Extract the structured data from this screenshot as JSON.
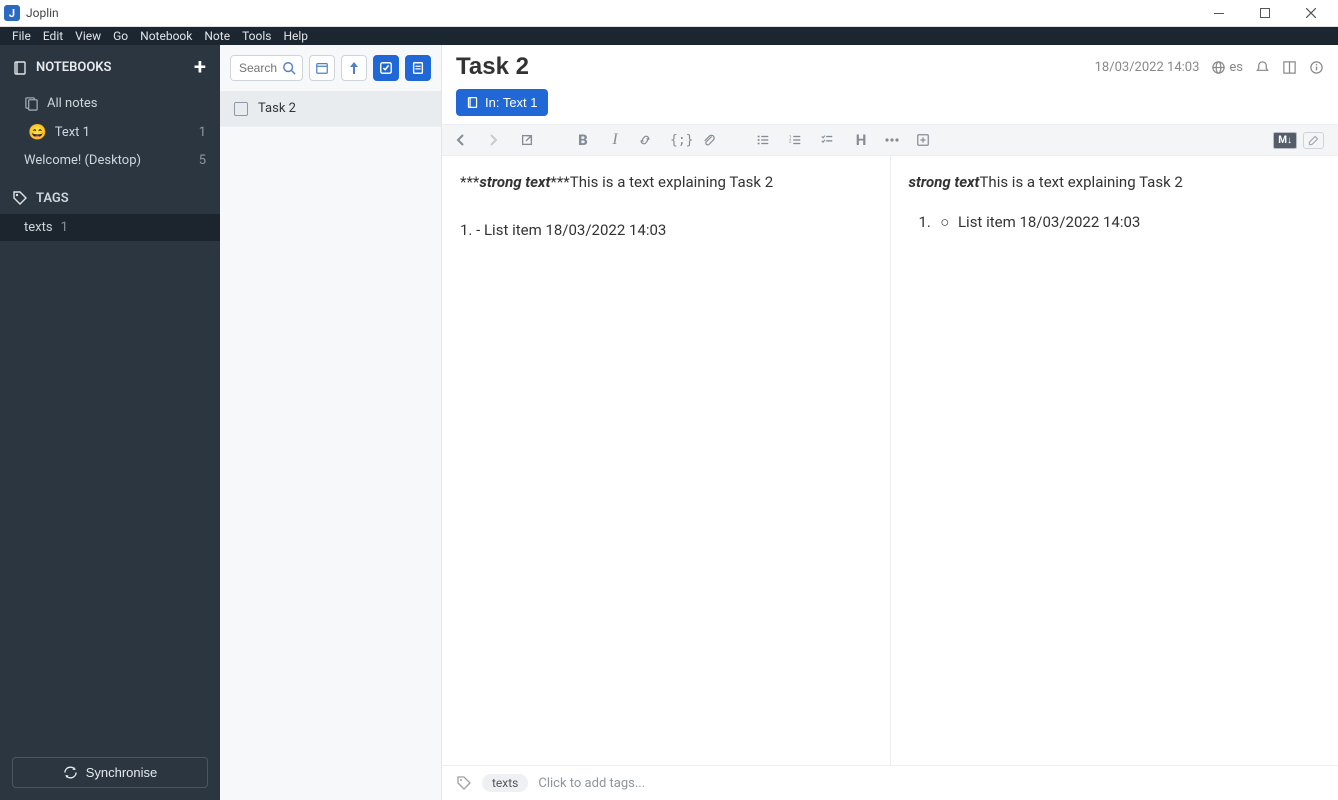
{
  "window": {
    "title": "Joplin"
  },
  "menu": [
    "File",
    "Edit",
    "View",
    "Go",
    "Notebook",
    "Note",
    "Tools",
    "Help"
  ],
  "sidebar": {
    "notebooksLabel": "NOTEBOOKS",
    "allNotes": "All notes",
    "notebooks": [
      {
        "name": "Text 1",
        "count": "1",
        "emoji": "😄"
      },
      {
        "name": "Welcome! (Desktop)",
        "count": "5"
      }
    ],
    "tagsLabel": "TAGS",
    "tags": [
      {
        "name": "texts",
        "count": "1"
      }
    ],
    "syncLabel": "Synchronise"
  },
  "noteList": {
    "searchPlaceholder": "Search...",
    "items": [
      {
        "title": "Task 2"
      }
    ]
  },
  "note": {
    "title": "Task 2",
    "timestamp": "18/03/2022 14:03",
    "lang": "es",
    "breadcrumb": "In: Text 1"
  },
  "editor": {
    "raw_prefix": "***",
    "raw_bold": "strong text",
    "raw_suffix": "***",
    "body_text": "This is a text explaining Task 2",
    "list_line": "1. - List item  18/03/2022 14:03"
  },
  "preview": {
    "bold": "strong text",
    "body_text": "This is a text explaining Task 2",
    "list_number": "1.",
    "list_text": "List item 18/03/2022 14:03"
  },
  "tagbar": {
    "tagpill": "texts",
    "placeholder": "Click to add tags..."
  }
}
